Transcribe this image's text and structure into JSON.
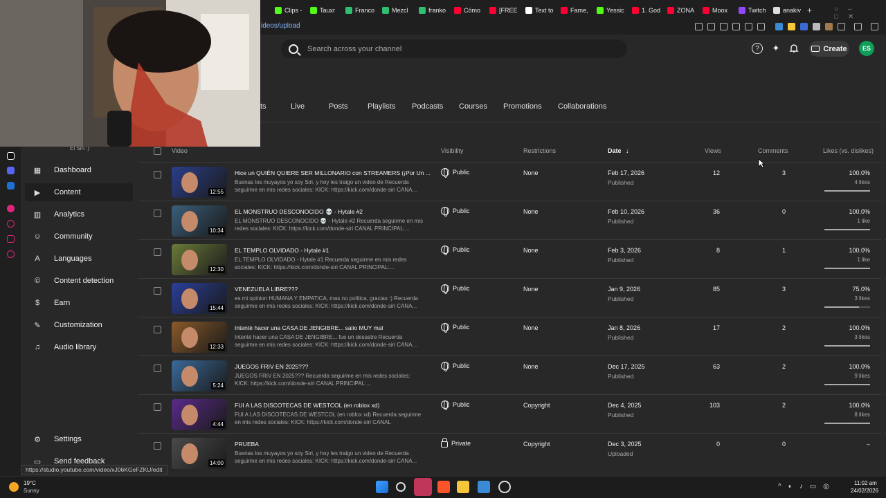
{
  "browser": {
    "tabs": [
      {
        "label": "Clips -",
        "color": "#53fc18"
      },
      {
        "label": "Tauxr",
        "color": "#53fc18"
      },
      {
        "label": "Franco",
        "color": "#2fbf71"
      },
      {
        "label": "Mezcl",
        "color": "#2fbf71"
      },
      {
        "label": "franko",
        "color": "#2fbf71"
      },
      {
        "label": "Cómo",
        "color": "#ff0033"
      },
      {
        "label": "[FREE",
        "color": "#ff0033"
      },
      {
        "label": "Text to",
        "color": "#ffffff"
      },
      {
        "label": "Fame,",
        "color": "#ff0033"
      },
      {
        "label": "Yessic",
        "color": "#53fc18"
      },
      {
        "label": "1. God",
        "color": "#ff0033"
      },
      {
        "label": "ZONA",
        "color": "#ff0033"
      },
      {
        "label": "Moox",
        "color": "#ff0033"
      },
      {
        "label": "Twitch",
        "color": "#9146ff"
      },
      {
        "label": "anakiv",
        "color": "#dddddd"
      }
    ],
    "url": "ideos/upload"
  },
  "header": {
    "search_placeholder": "Search across your channel",
    "create_label": "Create",
    "avatar_initials": "ES"
  },
  "content_tabs": [
    "ts",
    "Live",
    "Posts",
    "Playlists",
    "Podcasts",
    "Courses",
    "Promotions",
    "Collaborations"
  ],
  "sidebar": {
    "channel_name": "El Siri :)",
    "items": [
      {
        "label": "Dashboard",
        "icon": "dashboard-icon"
      },
      {
        "label": "Content",
        "icon": "content-icon",
        "active": true
      },
      {
        "label": "Analytics",
        "icon": "analytics-icon"
      },
      {
        "label": "Community",
        "icon": "community-icon"
      },
      {
        "label": "Languages",
        "icon": "languages-icon"
      },
      {
        "label": "Content detection",
        "icon": "copyright-icon"
      },
      {
        "label": "Earn",
        "icon": "earn-icon"
      },
      {
        "label": "Customization",
        "icon": "customization-icon"
      },
      {
        "label": "Audio library",
        "icon": "audio-library-icon"
      }
    ],
    "settings_label": "Settings",
    "feedback_label": "Send feedback"
  },
  "table": {
    "headers": {
      "video": "Video",
      "visibility": "Visibility",
      "restrictions": "Restrictions",
      "date": "Date",
      "views": "Views",
      "comments": "Comments",
      "likes": "Likes (vs. dislikes)"
    },
    "rows": [
      {
        "title": "Hice un QUIÉN QUIERE SER MILLONARIO con STREAMERS (¡Por Un ...",
        "desc": "Buenas los muyayos yo soy Siri, y hoy les traigo un video de Recuerda seguirme en mis redes sociales: KICK: https://kick.com/donde-siri CANA...",
        "duration": "12:55",
        "visibility": "Public",
        "restrictions": "None",
        "date": "Feb 17, 2026",
        "status": "Published",
        "views": "12",
        "comments": "3",
        "likes": "100.0%",
        "likes_count": "4 likes",
        "like_ratio": 1.0,
        "thumb": "#2b3f8a"
      },
      {
        "title": "EL MONSTRUO DESCONOCIDO 💀 - Hytale #2",
        "desc": "EL MONSTRUO DESCONOCIDO 💀 - Hytale #2 Recuerda seguirme en mis redes sociales: KICK: https://kick.com/donde-siri CANAL PRINCIPAL:...",
        "duration": "10:34",
        "visibility": "Public",
        "restrictions": "None",
        "date": "Feb 10, 2026",
        "status": "Published",
        "views": "36",
        "comments": "0",
        "likes": "100.0%",
        "likes_count": "1 like",
        "like_ratio": 1.0,
        "thumb": "#3a5f7a"
      },
      {
        "title": "EL TEMPLO OLVIDADO - Hytale #1",
        "desc": "EL TEMPLO OLVIDADO - Hytale #1 Recuerda seguirme en mis redes sociales: KICK: https://kick.com/donde-siri CANAL PRINCIPAL:...",
        "duration": "12:30",
        "visibility": "Public",
        "restrictions": "None",
        "date": "Feb 3, 2026",
        "status": "Published",
        "views": "8",
        "comments": "1",
        "likes": "100.0%",
        "likes_count": "1 like",
        "like_ratio": 1.0,
        "thumb": "#6a7a3a"
      },
      {
        "title": "VENEZUELA LIBRE???",
        "desc": "es mi opinion HUMANA Y EMPATICA, mas no politica, gracias :) Recuerda seguirme en mis redes sociales: KICK: https://kick.com/donde-siri CANA...",
        "duration": "15:44",
        "visibility": "Public",
        "restrictions": "None",
        "date": "Jan 9, 2026",
        "status": "Published",
        "views": "85",
        "comments": "3",
        "likes": "75.0%",
        "likes_count": "3 likes",
        "like_ratio": 0.75,
        "thumb": "#2a3f9a"
      },
      {
        "title": "Intenté hacer una CASA DE JENGIBRE... salio MUY mal",
        "desc": "Intenté hacer una CASA DE JENGIBRE... fue un desastre Recuerda seguirme en mis redes sociales: KICK: https://kick.com/donde-siri CANA...",
        "duration": "12:33",
        "visibility": "Public",
        "restrictions": "None",
        "date": "Jan 8, 2026",
        "status": "Published",
        "views": "17",
        "comments": "2",
        "likes": "100.0%",
        "likes_count": "3 likes",
        "like_ratio": 1.0,
        "thumb": "#8a5a2a"
      },
      {
        "title": "JUEGOS FRIV EN 2025???",
        "desc": "JUEGOS FRIV EN 2025??? Recuerda seguirme en mis redes sociales: KICK: https://kick.com/donde-siri CANAL PRINCIPAL:...",
        "duration": "5:24",
        "visibility": "Public",
        "restrictions": "None",
        "date": "Dec 17, 2025",
        "status": "Published",
        "views": "63",
        "comments": "2",
        "likes": "100.0%",
        "likes_count": "9 likes",
        "like_ratio": 1.0,
        "thumb": "#3a6a9a"
      },
      {
        "title": "FUI A LAS DISCOTECAS DE WESTCOL (en roblox xd)",
        "desc": "FUI A LAS DISCOTECAS DE WESTCOL (en roblox xd) Recuerda seguirme en mis redes sociales: KICK: https://kick.com/donde-siri CANAL PRINCIPAL:...",
        "duration": "4:44",
        "visibility": "Public",
        "restrictions": "Copyright",
        "date": "Dec 4, 2025",
        "status": "Published",
        "views": "103",
        "comments": "2",
        "likes": "100.0%",
        "likes_count": "8 likes",
        "like_ratio": 1.0,
        "thumb": "#5a2a8a"
      },
      {
        "title": "PRUEBA",
        "desc": "Buenas los muyayos yo soy Siri, y hoy les traigo un video de Recuerda seguirme en mis redes sociales: KICK: https://kick.com/donde-siri CANA...",
        "duration": "14:00",
        "visibility": "Private",
        "restrictions": "Copyright",
        "date": "Dec 3, 2025",
        "status": "Uploaded",
        "views": "0",
        "comments": "0",
        "likes": "–",
        "likes_count": "",
        "like_ratio": 0,
        "thumb": "#4a4a4a"
      }
    ]
  },
  "status_url": "https://studio.youtube.com/video/xJ06KGeFZKU/edit",
  "taskbar": {
    "weather_temp": "19°C",
    "weather_desc": "Sunny",
    "time": "11:02 am",
    "date": "24/02/2026"
  }
}
